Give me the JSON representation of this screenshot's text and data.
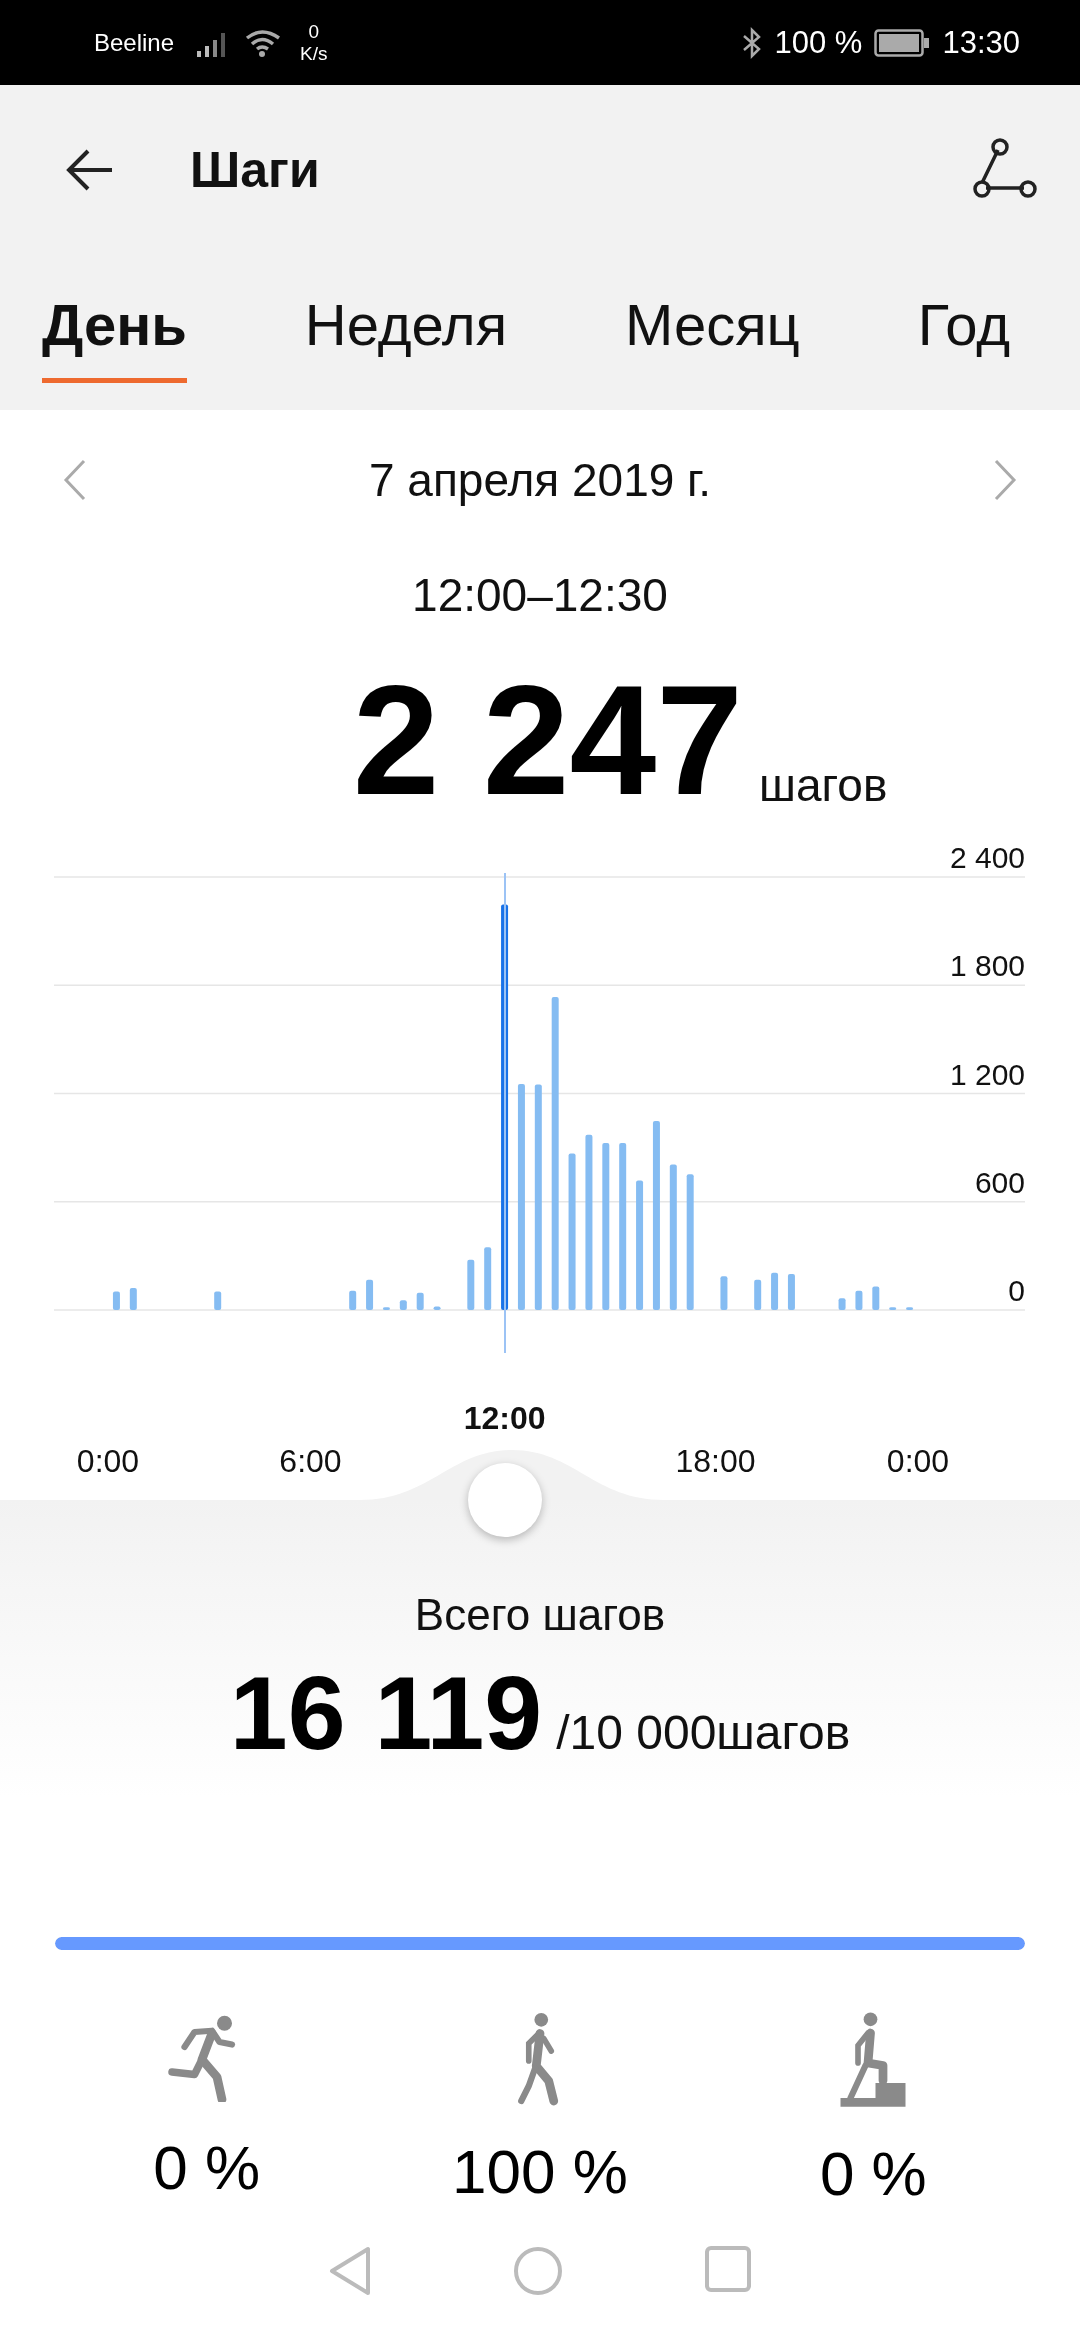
{
  "status_bar": {
    "carrier": "Beeline",
    "speed_value": "0",
    "speed_unit": "K/s",
    "battery": "100 %",
    "time": "13:30"
  },
  "app_bar": {
    "title": "Шаги"
  },
  "tabs": [
    {
      "label": "День",
      "selected": true
    },
    {
      "label": "Неделя",
      "selected": false
    },
    {
      "label": "Месяц",
      "selected": false
    },
    {
      "label": "Год",
      "selected": false
    }
  ],
  "date": "7 апреля 2019 г.",
  "selection": {
    "range": "12:00–12:30",
    "steps": "2 247",
    "unit": "шагов",
    "marker_label": "12:00"
  },
  "chart_data": {
    "type": "bar",
    "grid": true,
    "xlim": [
      0,
      24
    ],
    "ylim": [
      0,
      2400
    ],
    "x": [
      0.25,
      0.75,
      1.25,
      1.75,
      2.25,
      2.75,
      3.25,
      3.75,
      4.25,
      4.75,
      5.25,
      5.75,
      6.25,
      6.75,
      7.25,
      7.75,
      8.25,
      8.75,
      9.25,
      9.75,
      10.25,
      10.75,
      11.25,
      11.75,
      12.25,
      12.75,
      13.25,
      13.75,
      14.25,
      14.75,
      15.25,
      15.75,
      16.25,
      16.75,
      17.25,
      17.75,
      18.25,
      18.75,
      19.25,
      19.75,
      20.25,
      20.75,
      21.25,
      21.75,
      22.25,
      22.75,
      23.25,
      23.75
    ],
    "yticks": [
      {
        "value": 0,
        "label": "0"
      },
      {
        "value": 600,
        "label": "600"
      },
      {
        "value": 1200,
        "label": "1 200"
      },
      {
        "value": 1800,
        "label": "1 800"
      },
      {
        "value": 2400,
        "label": "2 400"
      }
    ],
    "xticks": [
      {
        "value": 0,
        "label": "0:00"
      },
      {
        "value": 6,
        "label": "6:00"
      },
      {
        "value": 18,
        "label": "18:00"
      },
      {
        "value": 24,
        "label": "0:00"
      }
    ],
    "series": [
      {
        "color": "#85bcf2",
        "values": [
          103,
          122,
          null,
          null,
          null,
          null,
          103,
          null,
          null,
          null,
          null,
          null,
          null,
          null,
          107,
          168,
          15,
          54,
          96,
          19,
          null,
          279,
          348,
          null,
          1253,
          1250,
          1735,
          867,
          971,
          925,
          925,
          718,
          1047,
          806,
          753,
          null,
          187,
          null,
          168,
          206,
          199,
          null,
          null,
          65,
          107,
          130,
          15,
          15
        ]
      },
      {
        "color": "#1a73e8",
        "values": [
          null,
          null,
          null,
          null,
          null,
          null,
          null,
          null,
          null,
          null,
          null,
          null,
          null,
          null,
          null,
          null,
          null,
          null,
          null,
          null,
          null,
          null,
          null,
          2247,
          null,
          null,
          null,
          null,
          null,
          null,
          null,
          null,
          null,
          null,
          null,
          null,
          null,
          null,
          null,
          null,
          null,
          null,
          null,
          null,
          null,
          null,
          null,
          null
        ]
      }
    ]
  },
  "total": {
    "label": "Всего шагов",
    "steps": "16 119",
    "goal": "/10 000шагов",
    "level": 1.0
  },
  "activities": [
    {
      "kind": "run",
      "percent": "0 %"
    },
    {
      "kind": "walk",
      "percent": "100 %"
    },
    {
      "kind": "climb",
      "percent": "0 %"
    }
  ]
}
